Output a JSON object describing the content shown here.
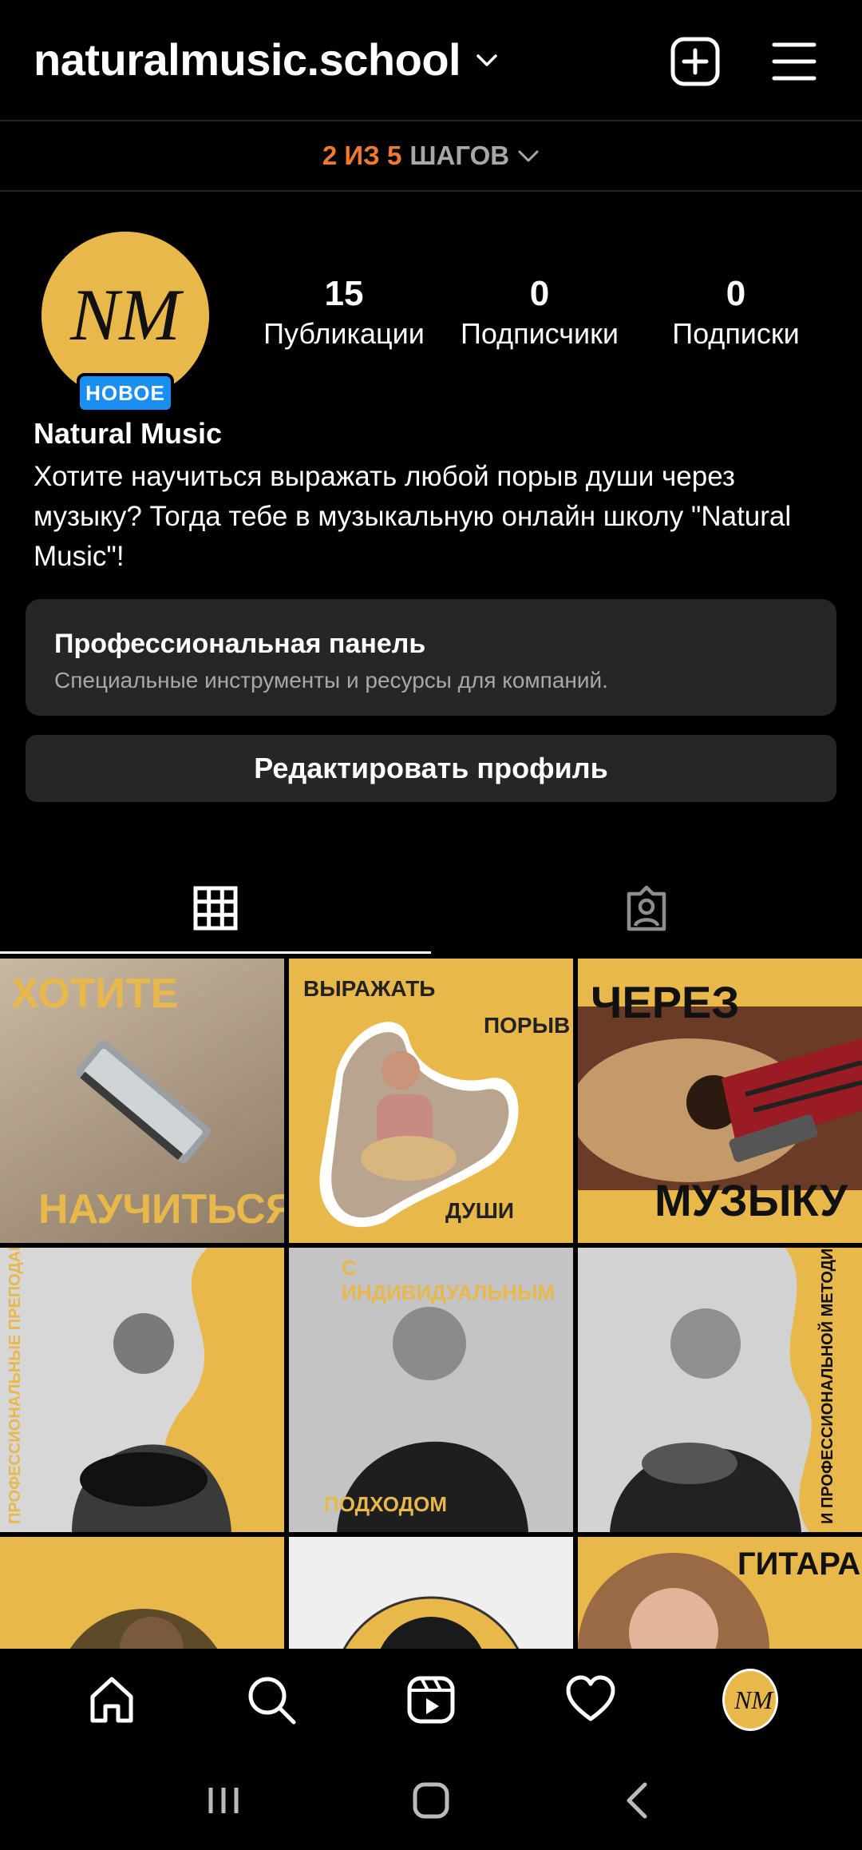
{
  "header": {
    "username": "naturalmusic.school",
    "icons": [
      "chevron-down-icon",
      "new-post-icon",
      "menu-icon"
    ]
  },
  "steps": {
    "accent": "2 ИЗ 5",
    "rest": "ШАГОВ"
  },
  "profile": {
    "avatar_initials": "NM",
    "badge": "НОВОЕ",
    "stats": [
      {
        "value": "15",
        "label": "Публикации"
      },
      {
        "value": "0",
        "label": "Подписчики"
      },
      {
        "value": "0",
        "label": "Подписки"
      }
    ],
    "display_name": "Natural Music",
    "bio": "Хотите научиться выражать любой порыв души через музыку? Тогда тебе в музыкальную онлайн школу \"Natural Music\"!"
  },
  "pro_panel": {
    "title": "Профессиональная панель",
    "subtitle": "Специальные инструменты и ресурсы для компаний."
  },
  "edit_profile_label": "Редактировать профиль",
  "tabs": [
    {
      "icon": "grid-icon",
      "active": true
    },
    {
      "icon": "tagged-icon",
      "active": false
    }
  ],
  "posts": [
    {
      "captions": [
        "ХОТИТЕ",
        "НАУЧИТЬСЯ"
      ]
    },
    {
      "captions": [
        "ВЫРАЖАТЬ",
        "ПОРЫВ",
        "ДУШИ"
      ]
    },
    {
      "captions": [
        "ЧЕРЕЗ",
        "МУЗЫКУ"
      ]
    },
    {
      "captions": [
        "ПРОФЕССИОНАЛЬНЫЕ ПРЕПОДАВАТЕЛИ"
      ]
    },
    {
      "captions": [
        "С ИНДИВИДУАЛЬНЫМ",
        "ПОДХОДОМ"
      ]
    },
    {
      "captions": [
        "И ПРОФЕССИОНАЛЬНОЙ МЕТОДИКОЙ"
      ]
    },
    {
      "captions": []
    },
    {
      "captions": []
    },
    {
      "captions": [
        "ГИТАРА"
      ]
    }
  ],
  "bottom_nav": [
    "home-icon",
    "search-icon",
    "reels-icon",
    "heart-icon",
    "profile-avatar"
  ],
  "system_nav": [
    "recents-icon",
    "home-button-icon",
    "back-icon"
  ],
  "colors": {
    "accent_orange": "#f07b2c",
    "badge_blue": "#1b8ef2",
    "brand_yellow": "#e8b84b",
    "panel_gray": "#262626"
  }
}
